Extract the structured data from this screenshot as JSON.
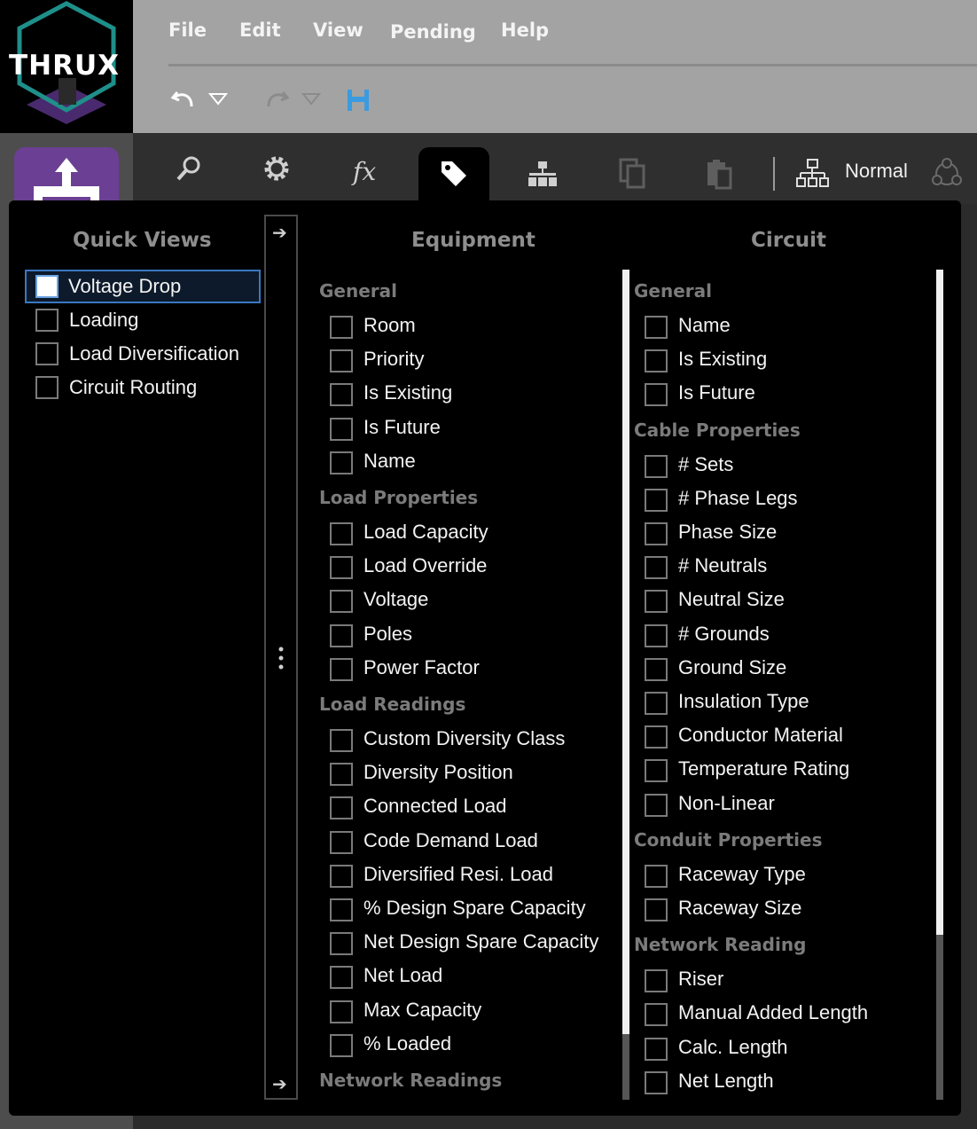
{
  "app": {
    "logo_text": "THRUX",
    "menu": [
      "File",
      "Edit",
      "View",
      "Pending",
      "Help"
    ],
    "mode_label": "Normal"
  },
  "toolbar_icons": [
    "search-icon",
    "gear-icon",
    "function-icon",
    "tag-icon",
    "hierarchy-icon",
    "copy-icon",
    "paste-icon",
    "network-icon",
    "share-icon"
  ],
  "quick_views": {
    "title": "Quick Views",
    "items": [
      "Voltage Drop",
      "Loading",
      "Load Diversification",
      "Circuit Routing"
    ],
    "selected": "Voltage Drop"
  },
  "equipment": {
    "title": "Equipment",
    "sections": [
      {
        "name": "General",
        "items": [
          "Room",
          "Priority",
          "Is Existing",
          "Is Future",
          "Name"
        ]
      },
      {
        "name": "Load Properties",
        "items": [
          "Load Capacity",
          "Load Override",
          "Voltage",
          "Poles",
          "Power Factor"
        ]
      },
      {
        "name": "Load Readings",
        "items": [
          "Custom Diversity Class",
          "Diversity Position",
          "Connected Load",
          "Code Demand Load",
          "Diversified Resi. Load",
          "% Design Spare Capacity",
          "Net Design Spare Capacity",
          "Net Load",
          "Max Capacity",
          "% Loaded"
        ]
      },
      {
        "name": "Network Readings",
        "items": []
      }
    ]
  },
  "circuit": {
    "title": "Circuit",
    "sections": [
      {
        "name": "General",
        "items": [
          "Name",
          "Is Existing",
          "Is Future"
        ]
      },
      {
        "name": "Cable Properties",
        "items": [
          "# Sets",
          "# Phase Legs",
          "Phase Size",
          "# Neutrals",
          "Neutral Size",
          "# Grounds",
          "Ground Size",
          "Insulation Type",
          "Conductor Material",
          "Temperature Rating",
          "Non-Linear"
        ]
      },
      {
        "name": "Conduit Properties",
        "items": [
          "Raceway Type",
          "Raceway Size"
        ]
      },
      {
        "name": "Network Reading",
        "items": [
          "Riser",
          "Manual Added Length",
          "Calc. Length",
          "Net Length"
        ]
      }
    ]
  },
  "colors": {
    "menubar": "#a3a3a3",
    "accent_purple": "#6b3f93",
    "selection_blue": "#3a78c0",
    "save_blue": "#3a9be0",
    "logo_teal": "#1f8f8a"
  }
}
